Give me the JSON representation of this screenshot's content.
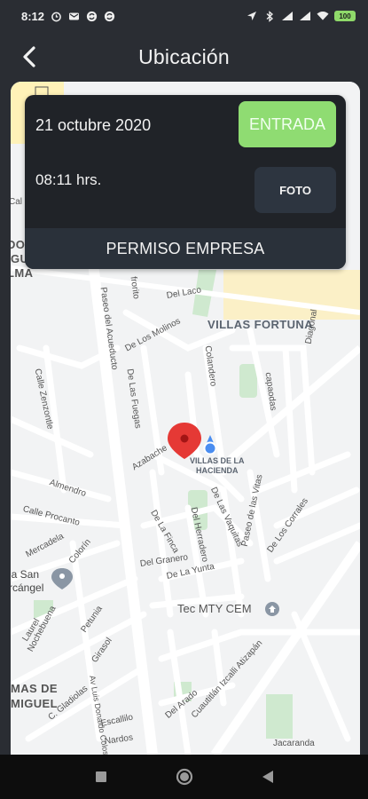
{
  "status_bar": {
    "time": "8:12",
    "battery": "100",
    "left_icons": [
      "alarm-icon",
      "mail-icon",
      "sync-icon",
      "sync-icon-2"
    ],
    "right_icons": [
      "location-arrow-icon",
      "bluetooth-icon",
      "signal-icon",
      "signal-icon-2",
      "wifi-icon",
      "battery-icon"
    ]
  },
  "header": {
    "title": "Ubicación",
    "back_icon": "chevron-left-icon"
  },
  "card": {
    "date": "21 octubre 2020",
    "time": "08:11 hrs.",
    "entrada_label": "ENTRADA",
    "foto_label": "FOTO",
    "permiso_label": "PERMISO EMPRESA"
  },
  "map": {
    "areas": {
      "villas_fortuna": "VILLAS FORTUNA",
      "villas_hacienda": "VILLAS DE LA\nHACIENDA",
      "tec": "Tec MTY CEM",
      "san_arcangel_1": "ia San",
      "san_arcangel_2": "rcángel",
      "mas_de": "MAS DE",
      "miguel": "MIGUEL",
      "do": "DO",
      "igue": "IGUE",
      "lma": "LMA"
    },
    "streets": {
      "paseo_acueducto": "Paseo del Acueducto",
      "los_molinos": "De Los Molinos",
      "del_laco": "Del Laco",
      "las_fuegas": "De Las Fuegas",
      "frorito": "frorito",
      "colandero": "Colandero",
      "capaodas": "capaodas",
      "diagonal": "Diagonal",
      "zenzontle": "Calle Zenzontle",
      "azabache": "Azabache",
      "almendro": "Almendro",
      "procanto": "Calle Procanto",
      "mercadela": "Mercadela",
      "colorin": "Colorín",
      "la_finca": "De La Finca",
      "herradero": "Del Herradero",
      "las_vaquitas": "De Las Vaquitas",
      "las_vitas": "Paseo de las Vitas",
      "los_corrales": "De Los Corrales",
      "granero": "Del Granero",
      "la_yunta": "De La Yunta",
      "colosio": "Av Luis Donaldo Colosio Murrieta",
      "laurel": "Laurel",
      "nochebuena": "Nochebuena",
      "petunia": "Petunia",
      "girasol": "Girasol",
      "gladiolas": "C. Gladiolas",
      "escallilo": "Escallilo",
      "nardos": "Nardos",
      "arado": "Del Arado",
      "atizapan": "Cuautitlán Izcalli Atizapán",
      "jacaranda": "Jacaranda",
      "cal": "Cal"
    }
  },
  "nav_bar": {
    "buttons": [
      "recents-square-icon",
      "home-circle-icon",
      "back-triangle-icon"
    ]
  }
}
